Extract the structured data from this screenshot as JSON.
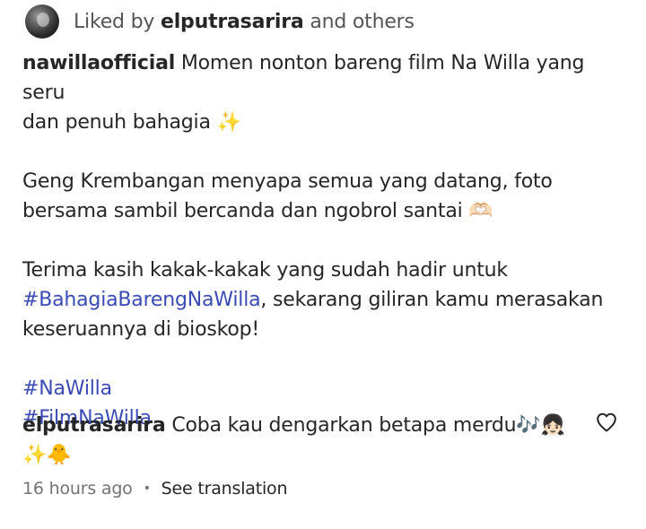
{
  "likes": {
    "prefix": "Liked by",
    "user": "elputrasarira",
    "suffix": "and others"
  },
  "caption": {
    "username": "nawillaofficial",
    "line1": "Momen nonton bareng film Na Willa yang seru",
    "line2": "dan penuh bahagia ✨",
    "para2_line1": "Geng Krembangan menyapa semua yang datang, foto",
    "para2_line2": "bersama sambil bercanda dan ngobrol santai 🫶🏻",
    "para3_line1": "Terima kasih kakak-kakak yang sudah hadir untuk",
    "para3_hashtag": "#BahagiaBarengNaWilla",
    "para3_rest": ", sekarang giliran kamu merasakan",
    "para3_line3": "keseruannya di bioskop!",
    "hashtags": [
      "#NaWilla",
      "#FilmNaWilla"
    ]
  },
  "comment": {
    "username": "elputrasarira",
    "text": "Coba kau dengarkan betapa merdu🎶👧🏻",
    "text_line2": "✨🐥",
    "time": "16 hours ago",
    "separator": "•",
    "see_translation": "See translation"
  },
  "icons": {
    "avatar": "profile-avatar",
    "like": "heart-icon"
  },
  "colors": {
    "hashtag": "#3a4bb8",
    "text": "#262626",
    "muted": "#737373"
  }
}
